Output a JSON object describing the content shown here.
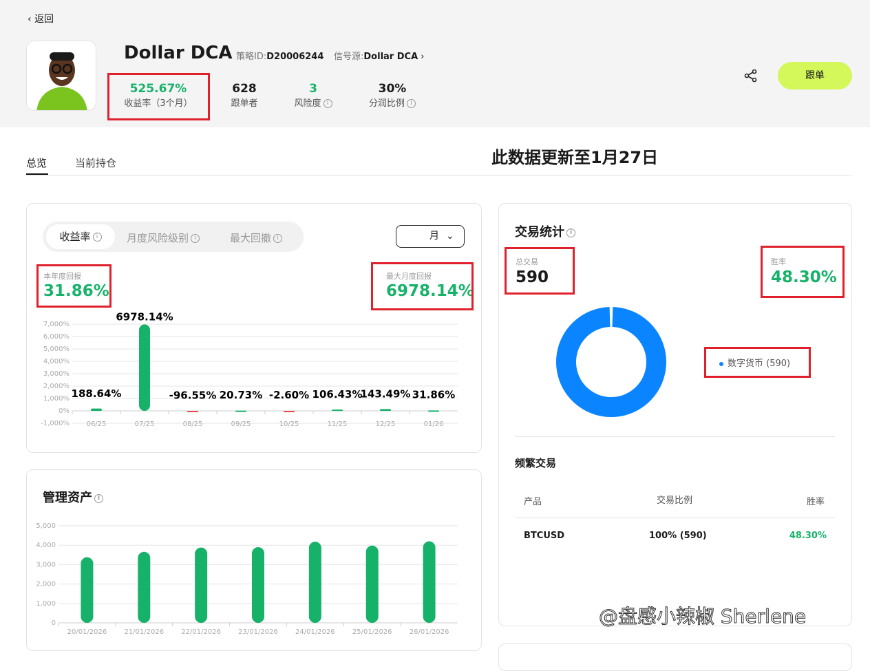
{
  "nav": {
    "back_label": "返回"
  },
  "profile": {
    "name": "Dollar DCA",
    "strategy_id_label": "策略ID:",
    "strategy_id": "D20006244",
    "signal_label": "信号源:",
    "signal": "Dollar DCA",
    "follow_label": "跟单"
  },
  "stats": [
    {
      "value": "525.67%",
      "label": "收益率（3个月）"
    },
    {
      "value": "628",
      "label": "跟单者"
    },
    {
      "value": "3",
      "label": "风险度"
    },
    {
      "value": "30%",
      "label": "分润比例"
    }
  ],
  "tabs": [
    {
      "label": "总览",
      "active": true
    },
    {
      "label": "当前持仓",
      "active": false
    }
  ],
  "notice": "此数据更新至1月27日",
  "returns_card": {
    "segments": [
      "收益率",
      "月度风险级别",
      "最大回撤"
    ],
    "period": "月",
    "ytd_label": "本年度回报",
    "ytd_value": "31.86%",
    "max_label": "最大月度回报",
    "max_value": "6978.14%"
  },
  "aum_card": {
    "title": "管理资产"
  },
  "trade_card": {
    "title": "交易统计",
    "total_label": "总交易",
    "total_value": "590",
    "winrate_label": "胜率",
    "winrate_value": "48.30%",
    "legend": "数字货币 (590)",
    "freq_title": "频繁交易",
    "columns": [
      "产品",
      "交易比例",
      "胜率"
    ],
    "rows": [
      {
        "product": "BTCUSD",
        "ratio": "100% (590)",
        "winrate": "48.30%"
      }
    ]
  },
  "watermark": "@盘感小辣椒 Sherlene",
  "colors": {
    "green": "#17b26a",
    "red": "#e5484d",
    "accent": "#d4f75a",
    "blue": "#0a84ff"
  },
  "chart_data": [
    {
      "type": "bar",
      "title": "收益率",
      "categories": [
        "06/25",
        "07/25",
        "08/25",
        "09/25",
        "10/25",
        "11/25",
        "12/25",
        "01/26"
      ],
      "values": [
        188.64,
        6978.14,
        -96.55,
        20.73,
        -2.6,
        106.43,
        143.49,
        31.86
      ],
      "labels": [
        "188.64%",
        "6978.14%",
        "-96.55%",
        "20.73%",
        "-2.60%",
        "106.43%",
        "143.49%",
        "31.86%"
      ],
      "yticks": [
        "-1,000%",
        "0%",
        "1,000%",
        "2,000%",
        "3,000%",
        "4,000%",
        "5,000%",
        "6,000%",
        "7,000%"
      ],
      "ylim": [
        -1000,
        7000
      ]
    },
    {
      "type": "bar",
      "title": "管理资产",
      "categories": [
        "20/01/2026",
        "21/01/2026",
        "22/01/2026",
        "23/01/2026",
        "24/01/2026",
        "25/01/2026",
        "26/01/2026"
      ],
      "values": [
        3380,
        3660,
        3880,
        3900,
        4180,
        3980,
        4200
      ],
      "yticks": [
        "0",
        "1,000",
        "2,000",
        "3,000",
        "4,000",
        "5,000"
      ],
      "ylim": [
        0,
        5000
      ]
    },
    {
      "type": "pie",
      "series": [
        {
          "name": "数字货币",
          "value": 590
        }
      ]
    }
  ]
}
